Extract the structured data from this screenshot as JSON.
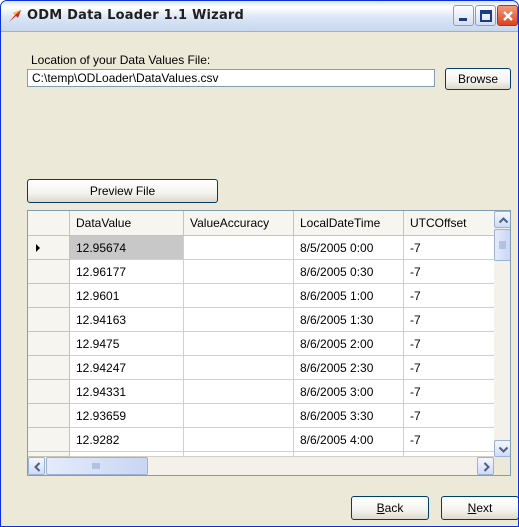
{
  "window": {
    "title": "ODM Data Loader 1.1 Wizard",
    "icons": [
      "app-icon",
      "minimize-icon",
      "maximize-icon",
      "close-icon"
    ]
  },
  "file_section": {
    "label": "Location of your Data Values File:",
    "path_value": "C:\\temp\\ODLoader\\DataValues.csv",
    "browse_label": "Browse"
  },
  "preview_button": "Preview File",
  "grid": {
    "columns": [
      "DataValue",
      "ValueAccuracy",
      "LocalDateTime",
      "UTCOffset"
    ],
    "rows": [
      {
        "value": "12.95674",
        "accuracy": "",
        "datetime": "8/5/2005 0:00",
        "offset": "-7"
      },
      {
        "value": "12.96177",
        "accuracy": "",
        "datetime": "8/6/2005 0:30",
        "offset": "-7"
      },
      {
        "value": "12.9601",
        "accuracy": "",
        "datetime": "8/6/2005 1:00",
        "offset": "-7"
      },
      {
        "value": "12.94163",
        "accuracy": "",
        "datetime": "8/6/2005 1:30",
        "offset": "-7"
      },
      {
        "value": "12.9475",
        "accuracy": "",
        "datetime": "8/6/2005 2:00",
        "offset": "-7"
      },
      {
        "value": "12.94247",
        "accuracy": "",
        "datetime": "8/6/2005 2:30",
        "offset": "-7"
      },
      {
        "value": "12.94331",
        "accuracy": "",
        "datetime": "8/6/2005 3:00",
        "offset": "-7"
      },
      {
        "value": "12.93659",
        "accuracy": "",
        "datetime": "8/6/2005 3:30",
        "offset": "-7"
      },
      {
        "value": "12.9282",
        "accuracy": "",
        "datetime": "8/6/2005 4:00",
        "offset": "-7"
      }
    ]
  },
  "nav": {
    "back_prefix": "",
    "back_accel": "B",
    "back_rest": "ack",
    "next_prefix": "",
    "next_accel": "N",
    "next_rest": "ext"
  },
  "colors": {
    "title_border": "#0831d9",
    "close_button": "#d9431e",
    "selected_cell": "#c8c8c8"
  }
}
